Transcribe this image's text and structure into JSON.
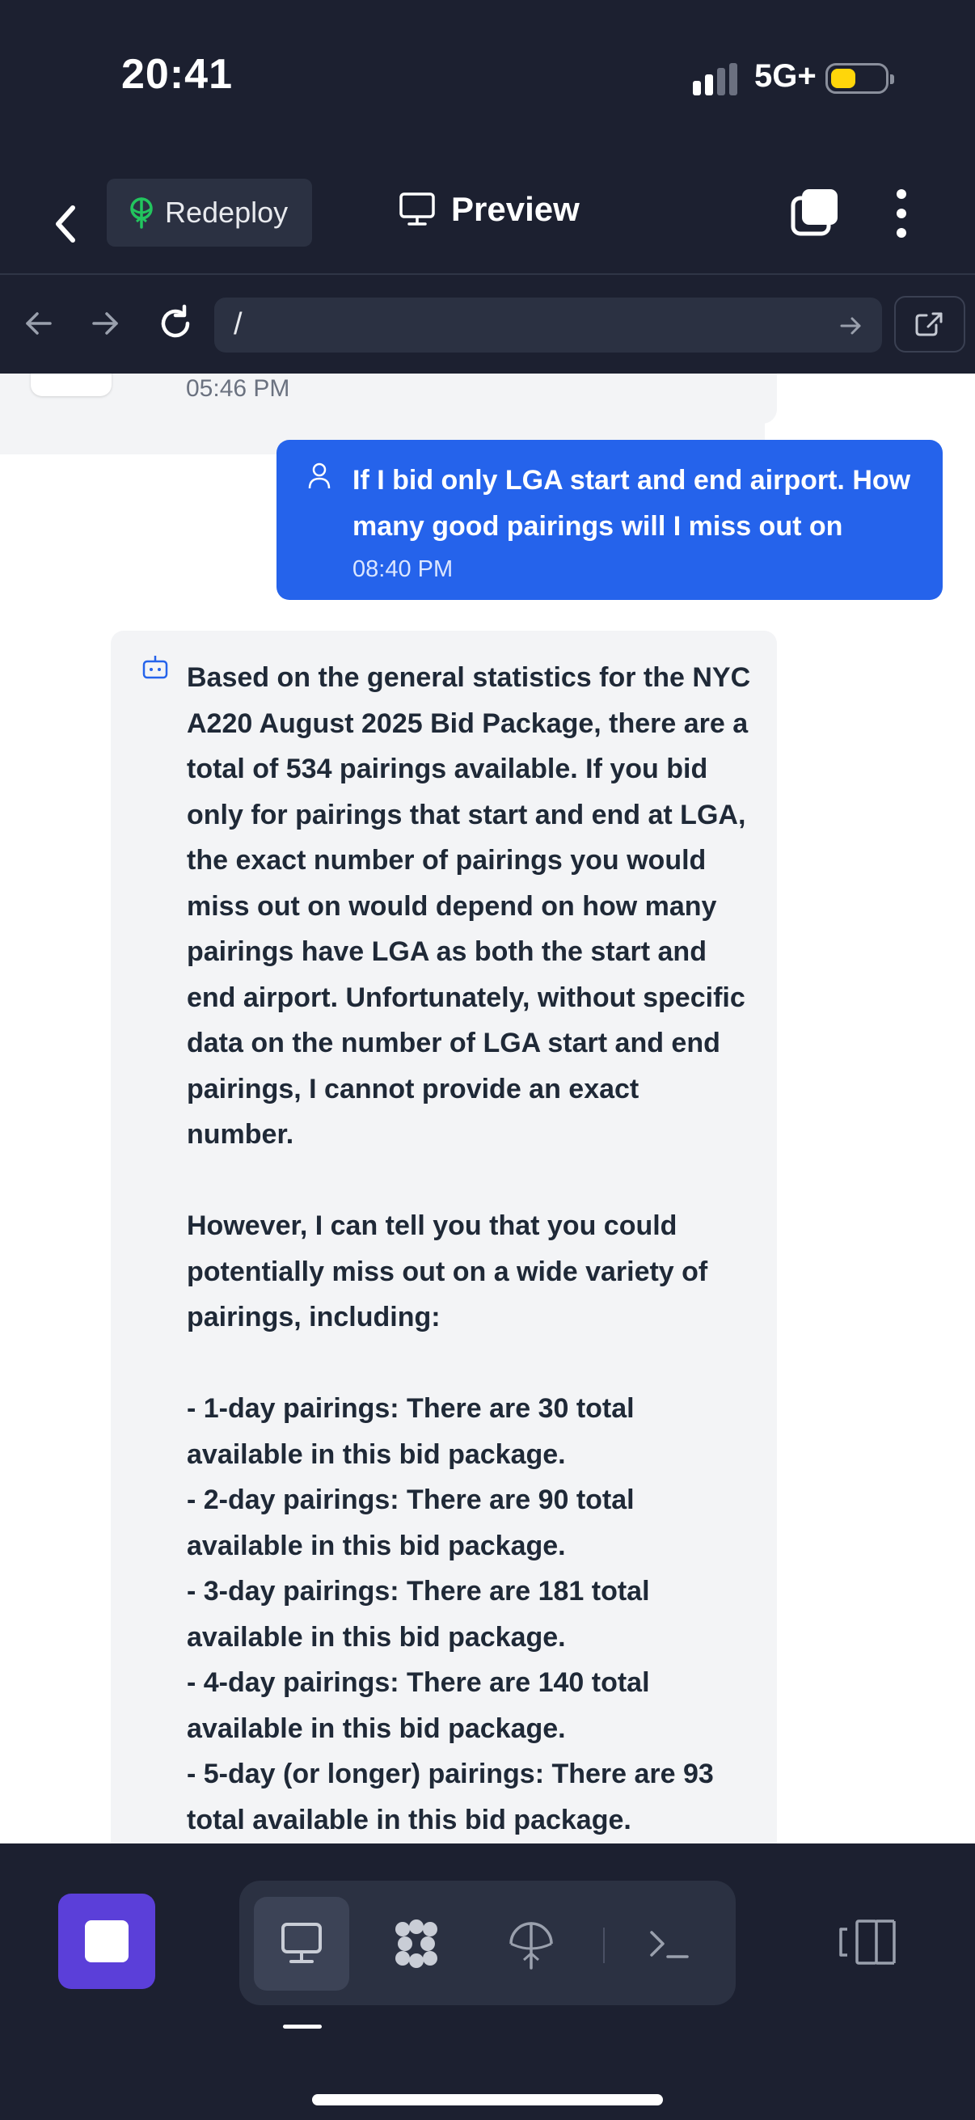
{
  "status_bar": {
    "time": "20:41",
    "network": "5G+",
    "battery_level": 0.45
  },
  "header": {
    "redeploy_label": "Redeploy",
    "preview_label": "Preview"
  },
  "address_bar": {
    "url": "/"
  },
  "chat": {
    "previous_time": "05:46 PM",
    "user_message": {
      "text": "If I bid only LGA start and end airport. How many good pairings will I miss out on",
      "time": "08:40 PM"
    },
    "assistant_message": {
      "text": "Based on the general statistics for the NYC A220 August 2025 Bid Package, there are a total of 534 pairings available. If you bid only for pairings that start and end at LGA, the exact number of pairings you would miss out on would depend on how many pairings have LGA as both the start and end airport. Unfortunately, without specific data on the number of LGA start and end pairings, I cannot provide an exact number.\n\nHowever, I can tell you that you could potentially miss out on a wide variety of pairings, including:\n\n- 1-day pairings: There are 30 total available in this bid package.\n- 2-day pairings: There are 90 total available in this bid package.\n- 3-day pairings: There are 181 total available in this bid package.\n- 4-day pairings: There are 140 total available in this bid package.\n- 5-day (or longer) pairings: There are 93 total available in this bid package."
    }
  },
  "bottom_bar": {
    "tools": [
      "desktop-icon",
      "apps-icon",
      "deploy-icon",
      "terminal-icon"
    ],
    "active_tool": "desktop-icon"
  },
  "colors": {
    "background": "#1c2030",
    "accent": "#2563eb",
    "stop_button": "#5b3fd9",
    "redeploy_icon": "#22c55e"
  }
}
